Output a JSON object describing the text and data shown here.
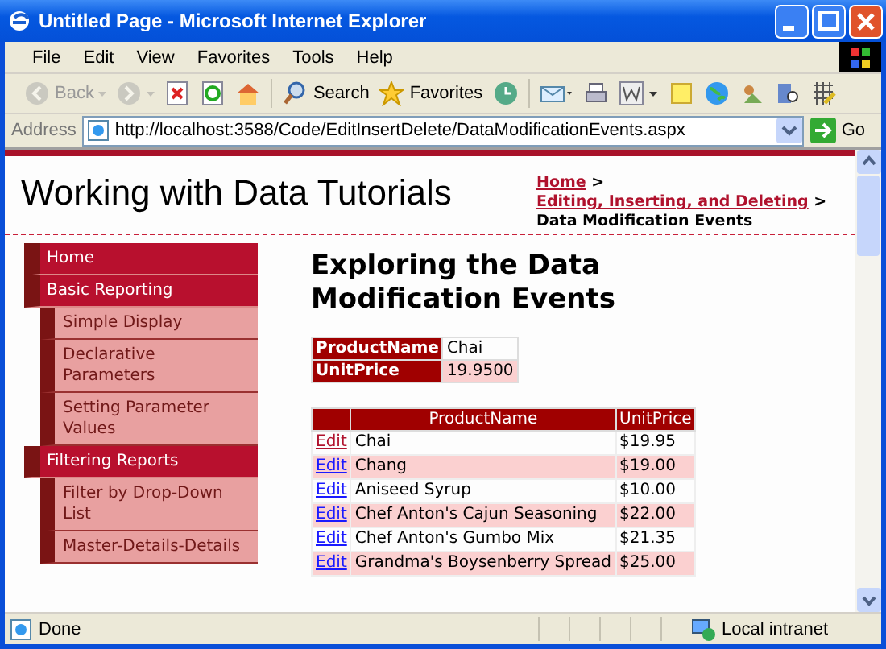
{
  "window": {
    "title": "Untitled Page - Microsoft Internet Explorer"
  },
  "menu_bar": [
    "File",
    "Edit",
    "View",
    "Favorites",
    "Tools",
    "Help"
  ],
  "toolbar": [
    {
      "kind": "back",
      "label": "Back",
      "disabled": true
    },
    {
      "kind": "forward",
      "disabled": true
    },
    {
      "kind": "stop"
    },
    {
      "kind": "refresh"
    },
    {
      "kind": "home"
    },
    {
      "kind": "search",
      "label": "Search"
    },
    {
      "kind": "favorites",
      "label": "Favorites"
    },
    {
      "kind": "history"
    },
    {
      "kind": "mail"
    },
    {
      "kind": "print"
    },
    {
      "kind": "edit"
    },
    {
      "kind": "note"
    },
    {
      "kind": "globe"
    },
    {
      "kind": "tool"
    },
    {
      "kind": "research"
    },
    {
      "kind": "grid"
    }
  ],
  "address_bar": {
    "label": "Address",
    "value": "http://localhost:3588/Code/EditInsertDelete/DataModificationEvents.aspx",
    "go": "Go"
  },
  "page": {
    "site_title": "Working with Data Tutorials",
    "breadcrumb": [
      {
        "text": "Home",
        "kind": "link"
      },
      {
        "text": ">",
        "kind": "separator"
      },
      {
        "text": "Editing, Inserting, and Deleting",
        "kind": "link"
      },
      {
        "text": ">",
        "kind": "separator"
      },
      {
        "text": "Data Modification Events",
        "kind": "current"
      }
    ],
    "menu": [
      {
        "label": "Home"
      },
      {
        "label": "Basic Reporting",
        "children": [
          {
            "label": "Simple Display"
          },
          {
            "label": "Declarative Parameters"
          },
          {
            "label": "Setting Parameter Values"
          }
        ]
      },
      {
        "label": "Filtering Reports",
        "children": [
          {
            "label": "Filter by Drop-Down List"
          },
          {
            "label": "Master-Details-Details"
          }
        ]
      }
    ],
    "heading": "Exploring the Data Modification Events",
    "details": [
      {
        "label": "ProductName",
        "value": "Chai"
      },
      {
        "label": "UnitPrice",
        "value": "19.9500"
      }
    ],
    "grid": {
      "columns": [
        "ProductName",
        "UnitPrice"
      ],
      "rows": [
        {
          "action": "Edit",
          "visited": true,
          "name": "Chai",
          "price": "$19.95"
        },
        {
          "action": "Edit",
          "visited": false,
          "name": "Chang",
          "price": "$19.00"
        },
        {
          "action": "Edit",
          "visited": false,
          "name": "Aniseed Syrup",
          "price": "$10.00"
        },
        {
          "action": "Edit",
          "visited": false,
          "name": "Chef Anton's Cajun Seasoning",
          "price": "$22.00"
        },
        {
          "action": "Edit",
          "visited": false,
          "name": "Chef Anton's Gumbo Mix",
          "price": "$21.35"
        },
        {
          "action": "Edit",
          "visited": false,
          "name": "Grandma's Boysenberry Spread",
          "price": "$25.00"
        }
      ]
    }
  },
  "status_bar": {
    "text": "Done",
    "zone": "Local intranet"
  }
}
